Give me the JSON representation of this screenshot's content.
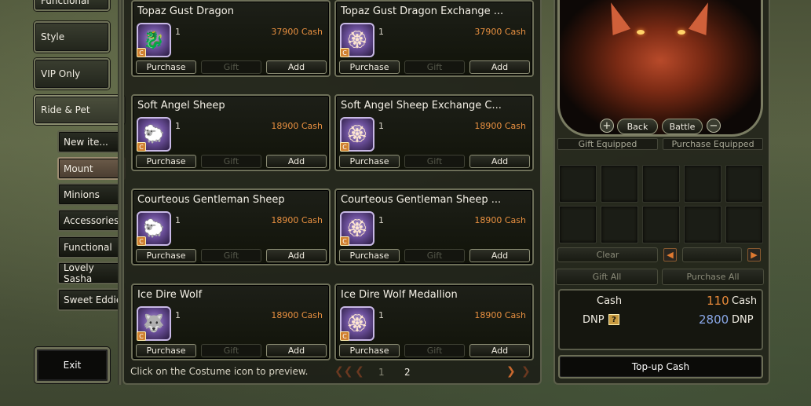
{
  "menu": {
    "functional_top": "Functional",
    "style": "Style",
    "vip_only": "VIP Only",
    "ride_pet": "Ride & Pet",
    "exit": "Exit"
  },
  "submenu": [
    {
      "label": "New ite...",
      "selected": false
    },
    {
      "label": "Mount",
      "selected": true
    },
    {
      "label": "Minions",
      "selected": false
    },
    {
      "label": "Accessories",
      "selected": false
    },
    {
      "label": "Functional",
      "selected": false
    },
    {
      "label": "Lovely Sasha",
      "selected": false
    },
    {
      "label": "Sweet Eddie",
      "selected": false
    }
  ],
  "buttons": {
    "purchase": "Purchase",
    "gift": "Gift",
    "add": "Add"
  },
  "items": [
    {
      "name": "Topaz Gust Dragon",
      "qty": "1",
      "price": "37900 Cash",
      "icon": "dragon-icon"
    },
    {
      "name": "Topaz Gust Dragon Exchange ...",
      "qty": "1",
      "price": "37900 Cash",
      "icon": "medallion-icon"
    },
    {
      "name": "Soft Angel Sheep",
      "qty": "1",
      "price": "18900 Cash",
      "icon": "sheep-icon"
    },
    {
      "name": "Soft Angel Sheep Exchange C...",
      "qty": "1",
      "price": "18900 Cash",
      "icon": "medallion-icon"
    },
    {
      "name": "Courteous Gentleman Sheep",
      "qty": "1",
      "price": "18900 Cash",
      "icon": "sheep-icon"
    },
    {
      "name": "Courteous Gentleman Sheep ...",
      "qty": "1",
      "price": "18900 Cash",
      "icon": "medallion-icon"
    },
    {
      "name": "Ice Dire Wolf",
      "qty": "1",
      "price": "18900 Cash",
      "icon": "wolf-icon"
    },
    {
      "name": "Ice Dire Wolf Medallion",
      "qty": "1",
      "price": "18900 Cash",
      "icon": "medallion-icon"
    }
  ],
  "hint": "Click on the Costume icon to preview.",
  "pager": {
    "page1": "1",
    "page2": "2"
  },
  "preview": {
    "back": "Back",
    "battle": "Battle",
    "gift_equipped": "Gift Equipped",
    "purchase_equipped": "Purchase Equipped"
  },
  "cart": {
    "clear": "Clear",
    "gift_all": "Gift All",
    "purchase_all": "Purchase All"
  },
  "wallet": {
    "cash_label": "Cash",
    "cash_value": "110",
    "cash_unit": "Cash",
    "dnp_label": "DNP",
    "dnp_help": "?",
    "dnp_value": "2800",
    "dnp_unit": "DNP"
  },
  "topup": "Top-up Cash",
  "colors": {
    "price": "#e89040",
    "accent": "#c8682e",
    "dnp": "#8aa8e8"
  }
}
